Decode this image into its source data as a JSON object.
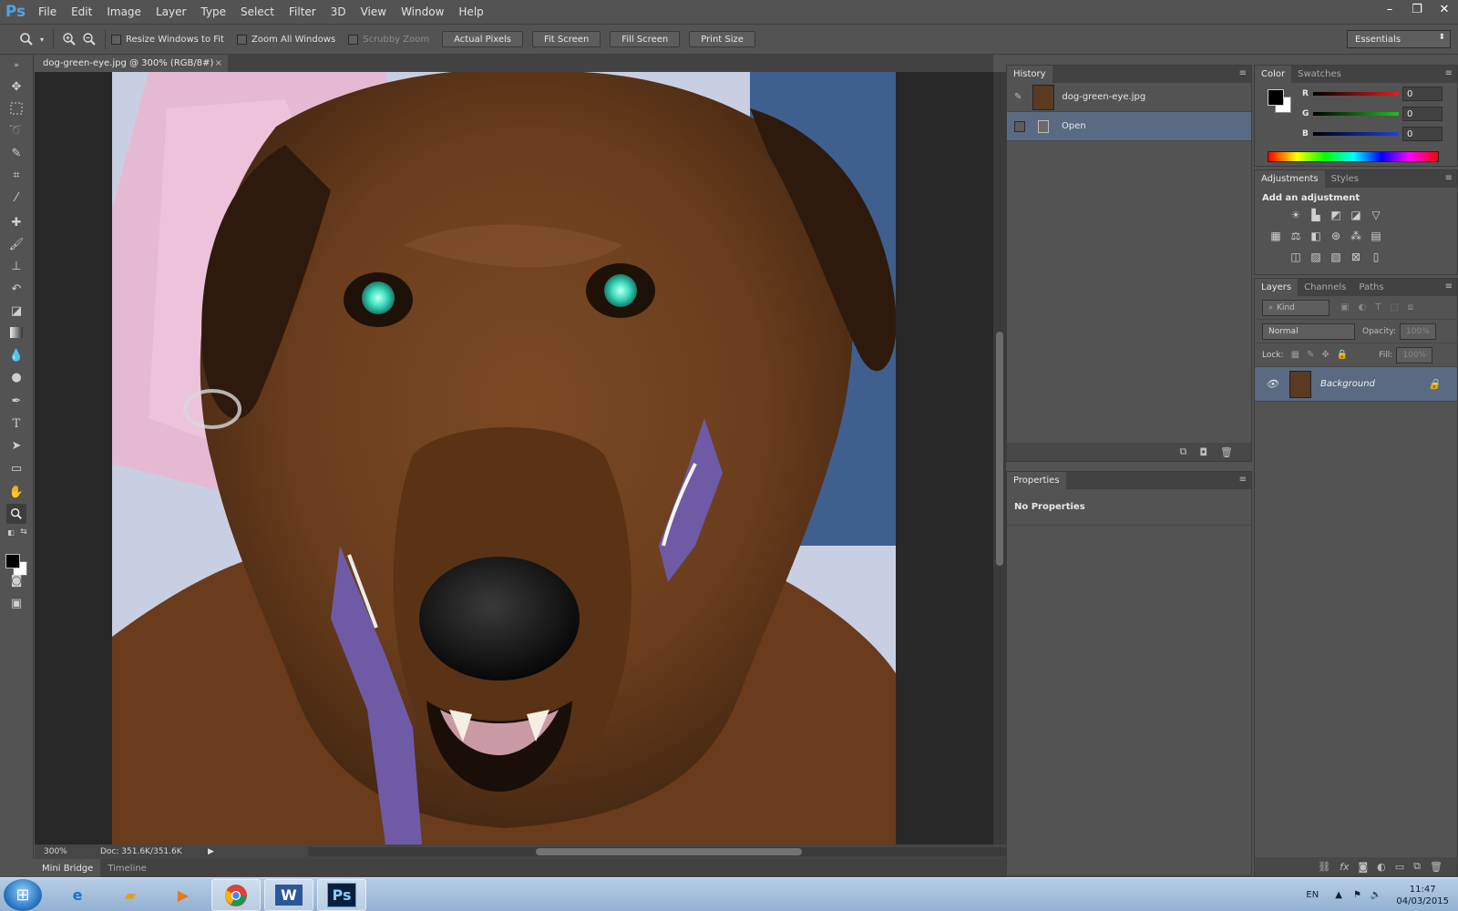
{
  "app": {
    "logo": "Ps",
    "menu": [
      "File",
      "Edit",
      "Image",
      "Layer",
      "Type",
      "Select",
      "Filter",
      "3D",
      "View",
      "Window",
      "Help"
    ],
    "window_controls": {
      "minimize": "–",
      "restore": "❐",
      "close": "✕"
    }
  },
  "options_bar": {
    "zoom_in_icon": "zoom-in-icon",
    "zoom_out_icon": "zoom-out-icon",
    "checks": [
      {
        "label": "Resize Windows to Fit",
        "checked": false,
        "enabled": true
      },
      {
        "label": "Zoom All Windows",
        "checked": false,
        "enabled": true
      },
      {
        "label": "Scrubby Zoom",
        "checked": false,
        "enabled": false
      }
    ],
    "buttons": [
      "Actual Pixels",
      "Fit Screen",
      "Fill Screen",
      "Print Size"
    ],
    "workspace": "Essentials"
  },
  "document": {
    "tab_title": "dog-green-eye.jpg @ 300% (RGB/8#)",
    "close": "×",
    "zoom": "300%",
    "doc_size": "Doc: 351.6K/351.6K"
  },
  "bottom_tabs": [
    "Mini Bridge",
    "Timeline"
  ],
  "history": {
    "tab": "History",
    "snapshot": "dog-green-eye.jpg",
    "steps": [
      "Open"
    ]
  },
  "properties": {
    "tab": "Properties",
    "body": "No Properties"
  },
  "color": {
    "tabs": [
      "Color",
      "Swatches"
    ],
    "foreground": "#000000",
    "background": "#ffffff",
    "channels": [
      {
        "label": "R",
        "value": "0",
        "color": "#e02020"
      },
      {
        "label": "G",
        "value": "0",
        "color": "#20c020"
      },
      {
        "label": "B",
        "value": "0",
        "color": "#2040e0"
      }
    ]
  },
  "adjustments": {
    "tabs": [
      "Adjustments",
      "Styles"
    ],
    "title": "Add an adjustment"
  },
  "layers": {
    "tabs": [
      "Layers",
      "Channels",
      "Paths"
    ],
    "kind": "Kind",
    "blend_mode": "Normal",
    "opacity_label": "Opacity:",
    "opacity_value": "100%",
    "lock_label": "Lock:",
    "fill_label": "Fill:",
    "fill_value": "100%",
    "items": [
      {
        "name": "Background",
        "visible": true,
        "locked": true
      }
    ]
  },
  "taskbar": {
    "language": "EN",
    "time": "11:47",
    "date": "04/03/2015"
  }
}
